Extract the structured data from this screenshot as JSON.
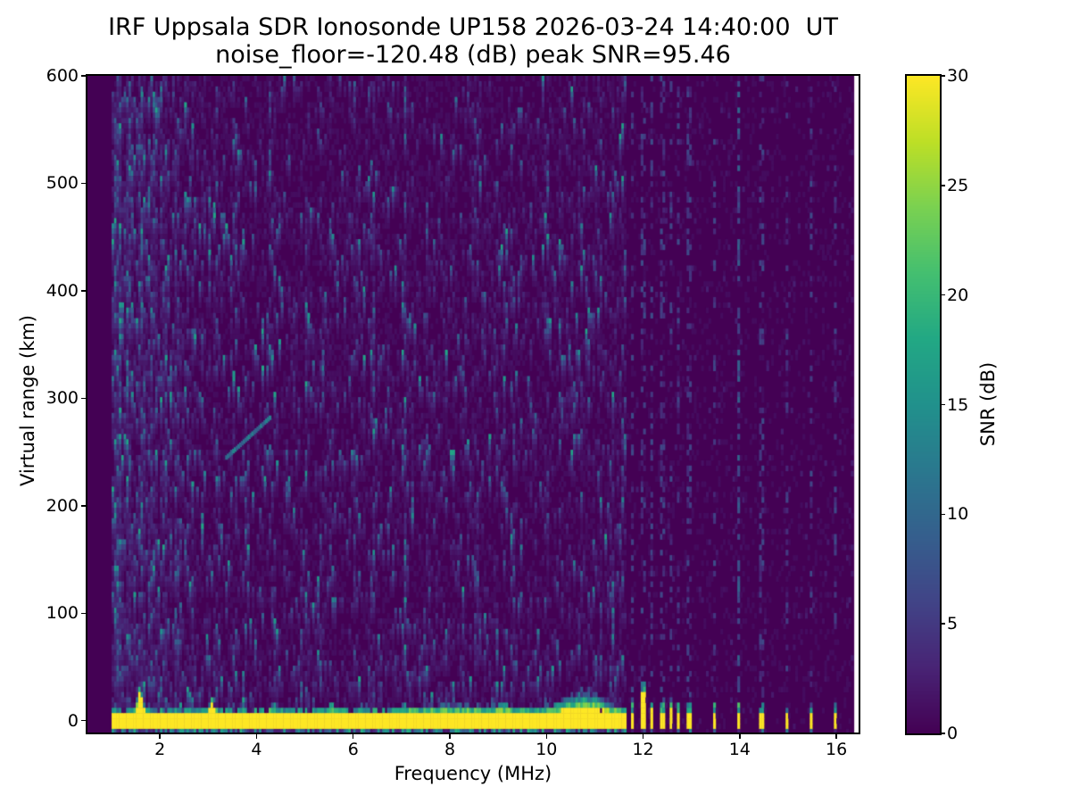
{
  "figure": {
    "title_line1": "IRF Uppsala SDR Ionosonde UP158 2026-03-24 14:40:00  UT",
    "title_line2": "noise_floor=-120.48 (dB) peak SNR=95.46"
  },
  "chart_data": {
    "type": "heatmap",
    "title": "IRF Uppsala SDR Ionosonde UP158 2026-03-24 14:40:00  UT",
    "subtitle": "noise_floor=-120.48 (dB) peak SNR=95.46",
    "xlabel": "Frequency (MHz)",
    "ylabel": "Virtual range (km)",
    "colorbar_label": "SNR (dB)",
    "x_tick_labels": [
      "2",
      "4",
      "6",
      "8",
      "10",
      "12",
      "14",
      "16"
    ],
    "y_tick_labels": [
      "0",
      "100",
      "200",
      "300",
      "400",
      "500",
      "600"
    ],
    "colorbar_tick_labels": [
      "0",
      "5",
      "10",
      "15",
      "20",
      "25",
      "30"
    ],
    "xlim": [
      0.5,
      16.46
    ],
    "ylim": [
      -11,
      600
    ],
    "clim": [
      0,
      30
    ],
    "noise_floor_db": -120.48,
    "peak_snr_db": 95.46,
    "colormap": "viridis",
    "colormap_stops": [
      [
        0.0,
        "#440154"
      ],
      [
        0.1,
        "#482475"
      ],
      [
        0.2,
        "#414487"
      ],
      [
        0.3,
        "#355f8d"
      ],
      [
        0.4,
        "#2a788e"
      ],
      [
        0.5,
        "#21918c"
      ],
      [
        0.6,
        "#22a884"
      ],
      [
        0.7,
        "#44bf70"
      ],
      [
        0.8,
        "#7ad151"
      ],
      [
        0.9,
        "#bddf26"
      ],
      [
        1.0,
        "#fde725"
      ]
    ],
    "data": {
      "seed": 20260324,
      "freq_start": 1.0,
      "freq_end": 16.37,
      "freq_step": 0.05,
      "range_step": 4.9,
      "sweep_continuous_end": 11.67,
      "background_value_max": 1.2,
      "ground_band": {
        "range_min": -7.5,
        "range_max": 7,
        "value": 30
      },
      "fringe_base_top_km": 11,
      "yellow_spikes": [
        {
          "f": 1.59,
          "amp": 21,
          "w": 0.04
        },
        {
          "f": 3.09,
          "amp": 12,
          "w": 0.04
        },
        {
          "f": 10.75,
          "amp": 5,
          "w": 0.35
        }
      ],
      "fringe_bumps": [
        {
          "f": 1.59,
          "amp": 22,
          "w": 0.05
        },
        {
          "f": 3.09,
          "amp": 13,
          "w": 0.05
        },
        {
          "f": 4.35,
          "amp": 6,
          "w": 0.05
        },
        {
          "f": 5.55,
          "amp": 7,
          "w": 0.06
        },
        {
          "f": 7.05,
          "amp": 5,
          "w": 0.08
        },
        {
          "f": 9.1,
          "amp": 6,
          "w": 0.12
        },
        {
          "f": 10.75,
          "amp": 14,
          "w": 0.4
        },
        {
          "f": 8.2,
          "amp": 4,
          "w": 0.7
        }
      ],
      "enhanced_noise_columns": [
        1.12,
        1.35,
        1.62,
        1.88,
        2.1,
        2.35,
        2.62,
        3.15,
        3.55,
        4.32,
        5.05,
        5.35,
        6.05,
        6.4,
        7.1,
        7.55,
        8.55,
        9.3,
        10.0,
        10.7,
        11.1,
        11.35,
        11.55
      ],
      "discrete_bars": [
        {
          "f": 11.77,
          "top": 14
        },
        {
          "f": 12.01,
          "top": 36
        },
        {
          "f": 12.18,
          "top": 16
        },
        {
          "f": 12.4,
          "top": 15
        },
        {
          "f": 12.58,
          "top": 16
        },
        {
          "f": 12.73,
          "top": 14
        },
        {
          "f": 12.95,
          "top": 15
        },
        {
          "f": 13.47,
          "top": 14
        },
        {
          "f": 13.97,
          "top": 13
        },
        {
          "f": 14.45,
          "top": 13
        },
        {
          "f": 14.98,
          "top": 13
        },
        {
          "f": 15.47,
          "top": 13
        },
        {
          "f": 15.97,
          "top": 14
        }
      ],
      "bright_dotted_column": 13.97,
      "dash_probability": 0.3,
      "bright_dash_probability": 0.5,
      "diagonal_echo": {
        "f0": 3.35,
        "r0": 247,
        "f1": 4.25,
        "r1": 284,
        "value": 11
      }
    }
  },
  "colors": {
    "figure_background": "#ffffff",
    "axes_line": "#000000",
    "text": "#000000",
    "viridis_min": "#440154",
    "viridis_max": "#fde725"
  }
}
